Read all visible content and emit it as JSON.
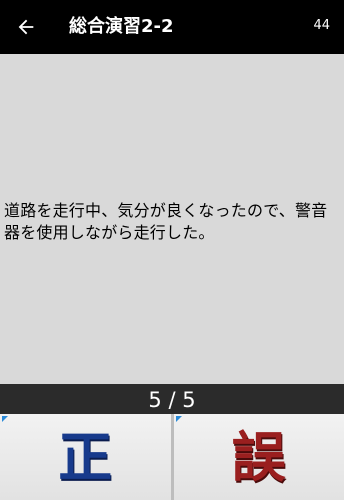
{
  "header": {
    "back_icon": "arrow-left-icon",
    "title": "総合演習2-2",
    "count": "44"
  },
  "question": {
    "text": "道路を走行中、気分が良くなったので、警音器を使用しながら走行した。"
  },
  "progress": {
    "current": 5,
    "total": 5,
    "text": "5 / 5"
  },
  "answers": {
    "correct_label": "正",
    "wrong_label": "誤",
    "correct_color": "#173a8c",
    "wrong_color": "#9a1f1f"
  },
  "colors": {
    "app_bar": "#000000",
    "question_bg": "#d9d9d9",
    "progress_bg": "#2b2b2b",
    "corner_accent": "#2a8ad8"
  }
}
